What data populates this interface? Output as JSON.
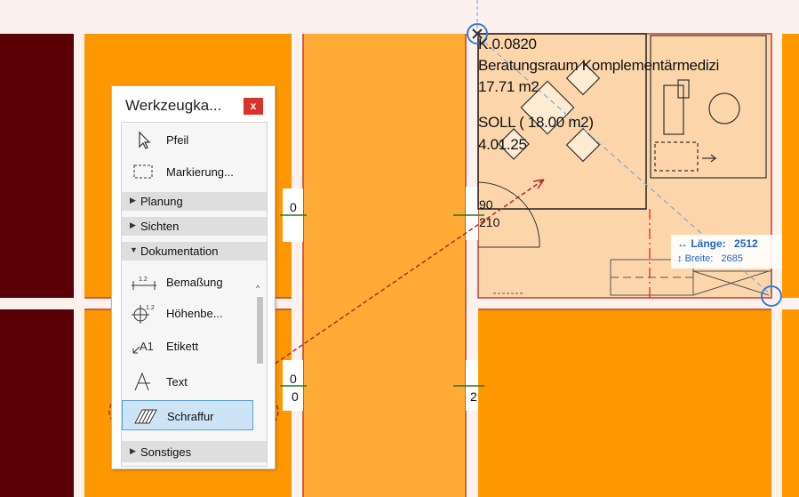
{
  "palette": {
    "title": "Werkzeugka...",
    "close_label": "x",
    "tools_top": [
      {
        "label": "Pfeil",
        "icon": "arrow-pointer-icon"
      },
      {
        "label": "Markierung...",
        "icon": "marquee-icon"
      }
    ],
    "groups": [
      {
        "label": "Planung",
        "state": "collapsed"
      },
      {
        "label": "Sichten",
        "state": "collapsed"
      },
      {
        "label": "Dokumentation",
        "state": "expanded"
      }
    ],
    "doc_tools": [
      {
        "label": "Bemaßung",
        "icon": "dimension-icon"
      },
      {
        "label": "Höhenbe...",
        "icon": "level-dimension-icon"
      },
      {
        "label": "Etikett",
        "icon": "label-icon"
      },
      {
        "label": "Text",
        "icon": "text-icon"
      },
      {
        "label": "Schraffur",
        "icon": "fill-hatch-icon",
        "selected": true
      }
    ],
    "footer_group": {
      "label": "Sonstiges",
      "state": "collapsed"
    }
  },
  "room_stamp": {
    "number": "K.0.0820",
    "name": "Beratungsraum Komplementärmedizi",
    "area": "17.71 m2",
    "target_area": "SOLL ( 18.00 m2)",
    "code": "4.01.25"
  },
  "door_labels": {
    "top_width": "90",
    "top_height": "210",
    "left_a": "0",
    "left_b": "0",
    "left_c": "0",
    "right_c": "2"
  },
  "dimension_tooltip": {
    "length_label": "Länge:",
    "length_value": "2512",
    "width_label": "Breite:",
    "width_value": "2685"
  },
  "colors": {
    "wall_dark": "#5a0005",
    "room_orange": "#ff9800",
    "corridor_orange": "#ffab36",
    "room_highlight": "#fcd6aa",
    "accent_blue": "#1f66c4",
    "selection_red": "#b32a2a"
  }
}
